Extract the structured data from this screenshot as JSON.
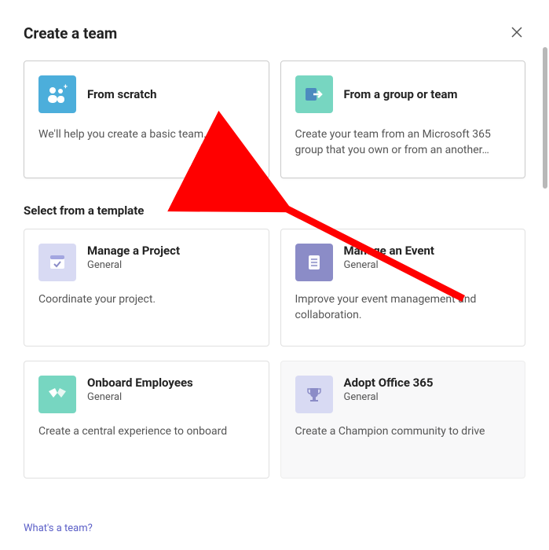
{
  "dialog": {
    "title": "Create a team"
  },
  "primary_cards": [
    {
      "title": "From scratch",
      "desc": "We'll help you create a basic team.",
      "icon": "people-plus-icon",
      "icon_bg": "#4caedb"
    },
    {
      "title": "From a group or team",
      "desc": "Create your team from an Microsoft 365 group that you own or from an another…",
      "icon": "group-arrow-icon",
      "icon_bg": "#77d6c1"
    }
  ],
  "template_section": {
    "heading": "Select from a template"
  },
  "template_cards": [
    {
      "title": "Manage a Project",
      "sub": "General",
      "desc": "Coordinate your project.",
      "icon": "calendar-check-icon",
      "icon_bg": "#d8daf3"
    },
    {
      "title": "Manage an Event",
      "sub": "General",
      "desc": "Improve your event management and collaboration.",
      "icon": "checklist-icon",
      "icon_bg": "#8b8cc7"
    },
    {
      "title": "Onboard Employees",
      "sub": "General",
      "desc": "Create a central experience to onboard",
      "icon": "handshake-icon",
      "icon_bg": "#77d6c1"
    },
    {
      "title": "Adopt Office 365",
      "sub": "General",
      "desc": "Create a Champion community to drive",
      "icon": "trophy-icon",
      "icon_bg": "#d8daf3"
    }
  ],
  "footer": {
    "link_text": "What's a team?"
  }
}
